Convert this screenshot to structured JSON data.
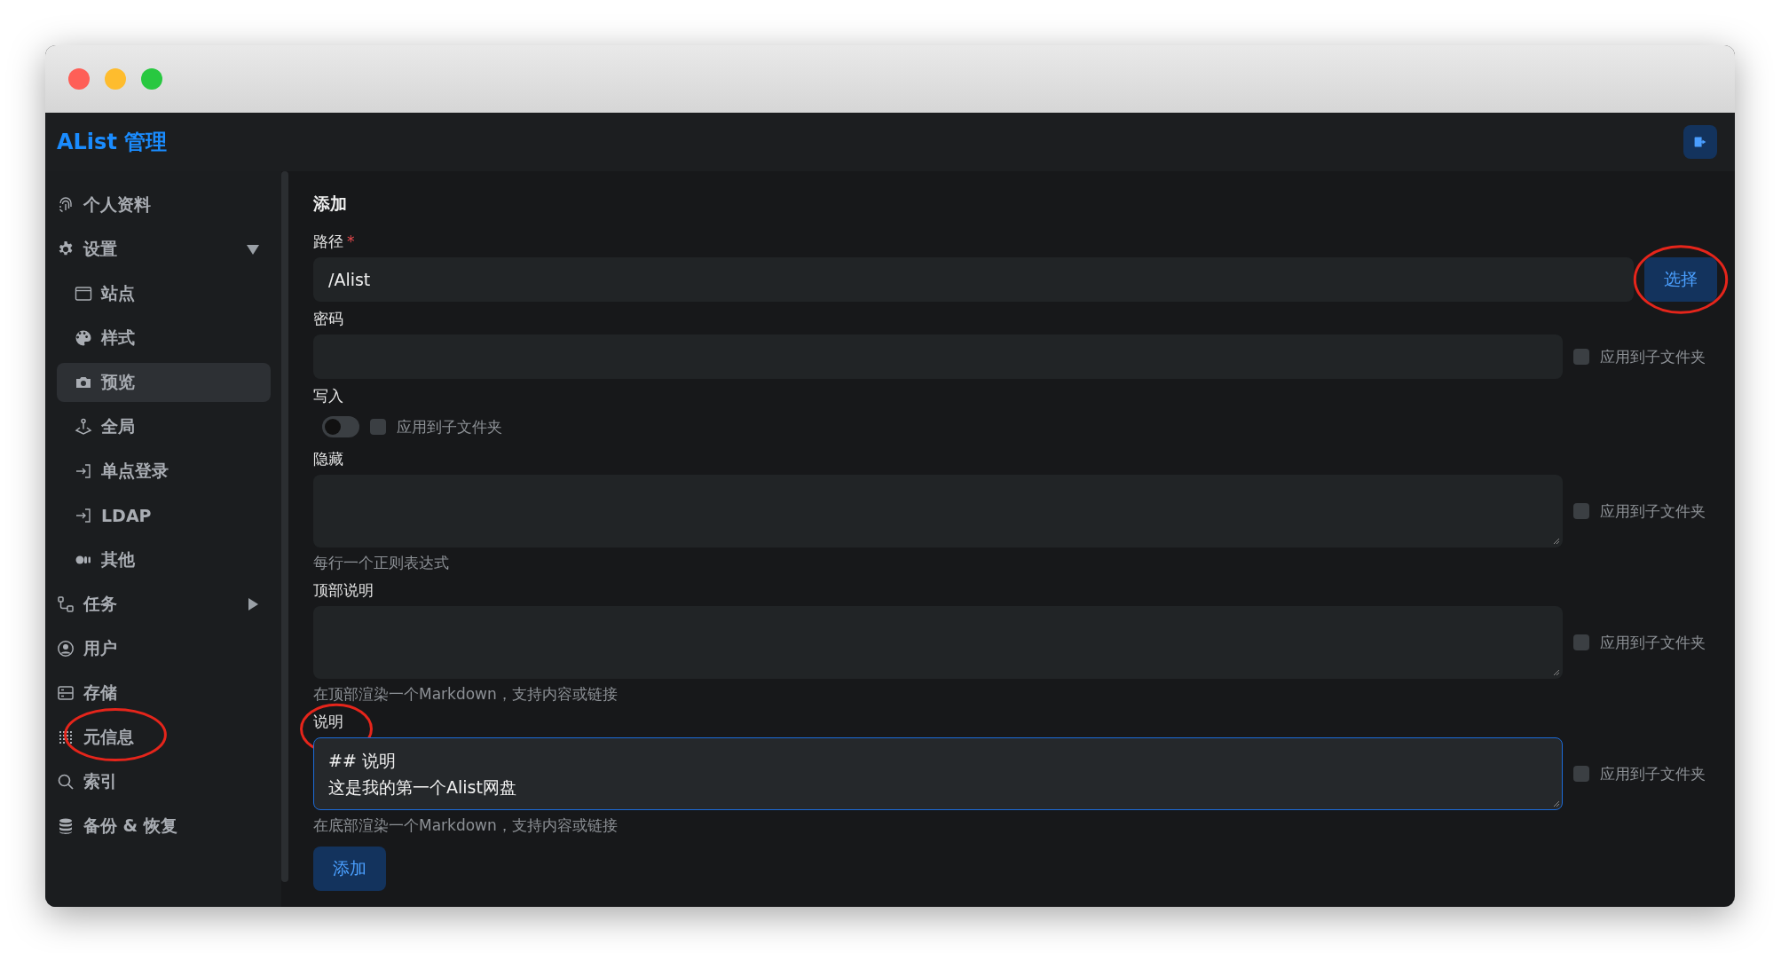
{
  "header": {
    "title": "AList 管理"
  },
  "sidebar": {
    "items": [
      {
        "label": "个人资料",
        "selected": false,
        "circled": false
      },
      {
        "label": "设置",
        "selected": false,
        "circled": false,
        "expanded": true,
        "children": [
          {
            "label": "站点",
            "selected": false,
            "circled": false
          },
          {
            "label": "样式",
            "selected": false,
            "circled": false
          },
          {
            "label": "预览",
            "selected": true,
            "circled": false
          },
          {
            "label": "全局",
            "selected": false,
            "circled": false
          },
          {
            "label": "单点登录",
            "selected": false,
            "circled": false
          },
          {
            "label": "LDAP",
            "selected": false,
            "circled": false
          },
          {
            "label": "其他",
            "selected": false,
            "circled": false
          }
        ]
      },
      {
        "label": "任务",
        "selected": false,
        "circled": false,
        "expanded": false
      },
      {
        "label": "用户",
        "selected": false,
        "circled": false
      },
      {
        "label": "存储",
        "selected": false,
        "circled": false
      },
      {
        "label": "元信息",
        "selected": false,
        "circled": true
      },
      {
        "label": "索引",
        "selected": false,
        "circled": false
      },
      {
        "label": "备份 & 恢复",
        "selected": false,
        "circled": false
      }
    ]
  },
  "form": {
    "title": "添加",
    "fields": [
      {
        "kind": "path",
        "label": "路径",
        "required_mark": "*",
        "label_circled": false,
        "value": "/Alist",
        "button": "选择",
        "button_circled": true
      },
      {
        "kind": "input",
        "label": "密码",
        "label_circled": false,
        "apply": {
          "label": "应用到子文件夹",
          "checked": false
        }
      },
      {
        "kind": "switch",
        "label": "写入",
        "label_circled": false,
        "on": false,
        "apply": {
          "label": "应用到子文件夹",
          "checked": false
        }
      },
      {
        "kind": "textarea",
        "label": "隐藏",
        "label_circled": false,
        "focused": false,
        "help": "每行一个正则表达式",
        "apply": {
          "label": "应用到子文件夹",
          "checked": false
        }
      },
      {
        "kind": "textarea",
        "label": "顶部说明",
        "label_circled": false,
        "focused": false,
        "help": "在顶部渲染一个Markdown，支持内容或链接",
        "apply": {
          "label": "应用到子文件夹",
          "checked": false
        }
      },
      {
        "kind": "textarea",
        "label": "说明",
        "label_circled": true,
        "focused": true,
        "lines": [
          "## 说明",
          "这是我的第一个Alist网盘"
        ],
        "help": "在底部渲染一个Markdown，支持内容或链接",
        "apply": {
          "label": "应用到子文件夹",
          "checked": false
        }
      }
    ],
    "submit": "添加"
  }
}
